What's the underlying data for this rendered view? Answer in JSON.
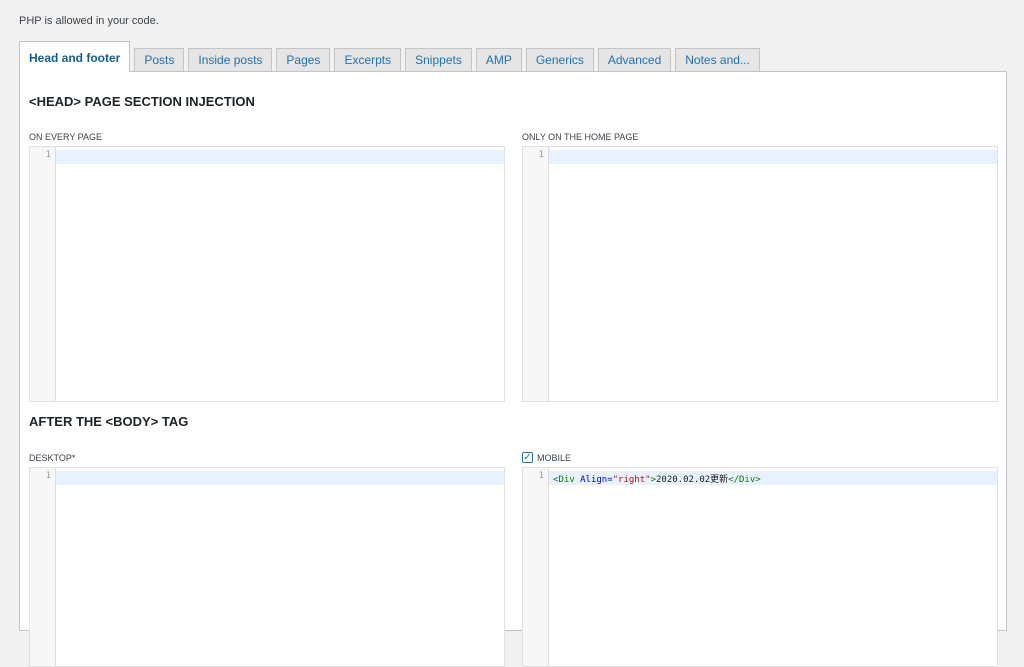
{
  "notice": "PHP is allowed in your code.",
  "tabs": [
    {
      "label": "Head and footer",
      "active": true
    },
    {
      "label": "Posts"
    },
    {
      "label": "Inside posts"
    },
    {
      "label": "Pages"
    },
    {
      "label": "Excerpts"
    },
    {
      "label": "Snippets"
    },
    {
      "label": "AMP"
    },
    {
      "label": "Generics"
    },
    {
      "label": "Advanced"
    },
    {
      "label": "Notes and..."
    }
  ],
  "head_section": {
    "title": "<HEAD> PAGE SECTION INJECTION",
    "every_page_label": "ON EVERY PAGE",
    "home_page_label": "ONLY ON THE HOME PAGE",
    "line_number": "1"
  },
  "body_section": {
    "title": "AFTER THE <BODY> TAG",
    "desktop_label": "DESKTOP*",
    "mobile_label": "MOBILE",
    "mobile_checked": true,
    "line_number": "1",
    "mobile_code": {
      "tag_open": "<Div",
      "attr": " Align=",
      "value": "\"right\"",
      "gt": ">",
      "text": "2020.02.02更新",
      "tag_close": "</Div>"
    }
  },
  "colors": {
    "accent": "#2271b1",
    "active_line": "#e8f2ff",
    "tag": "#117700",
    "attr": "#0000cc",
    "string": "#aa1111"
  }
}
